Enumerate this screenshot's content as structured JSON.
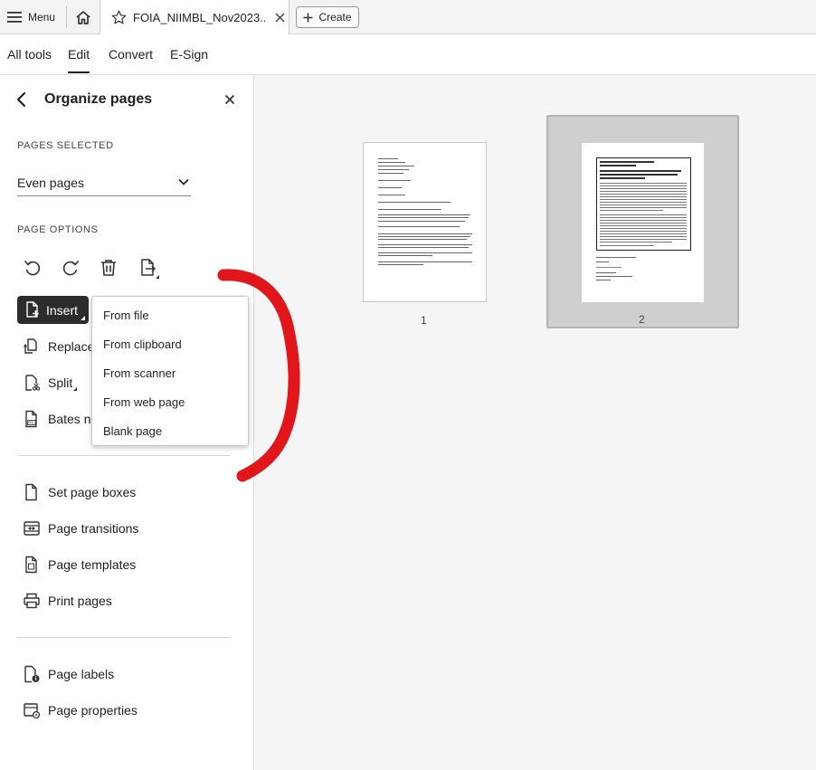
{
  "topbar": {
    "menu_label": "Menu",
    "tab_title": "FOIA_NIIMBL_Nov2023...",
    "create_label": "Create"
  },
  "tool_tabs": {
    "items": [
      "All tools",
      "Edit",
      "Convert",
      "E-Sign"
    ],
    "active": "Edit"
  },
  "panel": {
    "title": "Organize pages",
    "pages_selected_label": "PAGES SELECTED",
    "pages_selected_value": "Even pages",
    "page_options_label": "PAGE OPTIONS",
    "tool_icons": [
      "rotate-counterclockwise-icon",
      "rotate-clockwise-icon",
      "trash-icon",
      "extract-pages-icon"
    ],
    "insert_label": "Insert",
    "replace_label": "Replace",
    "split_label": "Split",
    "bates_label": "Bates nu",
    "set_page_boxes": "Set page boxes",
    "page_transitions": "Page transitions",
    "page_templates": "Page templates",
    "print_pages": "Print pages",
    "page_labels": "Page labels",
    "page_properties": "Page properties"
  },
  "insert_menu": {
    "items": [
      "From file",
      "From clipboard",
      "From scanner",
      "From web page",
      "Blank page"
    ]
  },
  "thumbnails": {
    "page1_number": "1",
    "page2_number": "2"
  },
  "colors": {
    "annotation": "#e0161b",
    "insert_bg": "#2c2c2c",
    "selected_frame": "#cfcfcf"
  }
}
